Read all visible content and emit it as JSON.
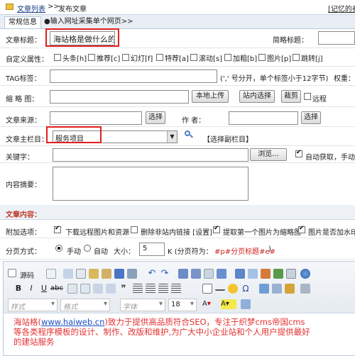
{
  "topbar": {
    "list_link": "文章列表",
    "sep": ">>",
    "current": "发布文章",
    "right_link": "[记忆的券"
  },
  "tabs": [
    "常规信息",
    "●输入网址采集单个网页>>"
  ],
  "title": {
    "label": "文章标题：",
    "value": "海站格是做什么的?",
    "short_label": "简略标题："
  },
  "attrs": {
    "label": "自定义属性：",
    "items": [
      "头条[h]",
      "推荐[c]",
      "幻灯[f]",
      "特荐[a]",
      "滚动[s]",
      "加粗[b]",
      "图片[p]",
      "跳转[j]"
    ]
  },
  "tag": {
    "label": "TAG标签：",
    "hint": "(',' 号分开，单个标签小于12字节)",
    "weight_label": "权重："
  },
  "thumb": {
    "label": "缩 略 图：",
    "upload": "本地上传",
    "site_select": "站内选择",
    "crop": "裁剪",
    "remote": "远程"
  },
  "source": {
    "label": "文章来源：",
    "select": "选择",
    "author_label": "作    者：",
    "author_select": "选择"
  },
  "column": {
    "label": "文章主栏目：",
    "value": "服务项目",
    "sub_column": "【选择副栏目】"
  },
  "keywords": {
    "label": "关键字：",
    "browse": "浏览...",
    "auto_label": "自动获取，手动填"
  },
  "summary": {
    "label": "内容摘要："
  },
  "content_header": "文章内容：",
  "options": {
    "label": "附加选项：",
    "items": [
      "下载远程图片和资源",
      "删除非站内链接 [设置]",
      "提取第一个图片为缩略图",
      "图片是否加水印"
    ],
    "checked": [
      true,
      false,
      true,
      true
    ]
  },
  "paging": {
    "label": "分页方式：",
    "manual": "手动",
    "auto": "自动",
    "size_label": "大小：",
    "size_value": "5",
    "unit": "K (分页符为：",
    "marker": "#p#分页标题#e#",
    "close": ")"
  },
  "editor": {
    "source_btn": "源码",
    "style_select": "样式",
    "format_select": "格式",
    "font_select": "字体",
    "size_select": "18",
    "content_link": "www.haiweb.cn",
    "content_pre": "海站格(",
    "content_post": ")致力于提供高品质符合SEO，专注于织梦cms帝国cms等各类程序模板的设计、制作、改版和维护,为广大中小企业站和个人用户提供最好的建站服务"
  },
  "colors": {
    "accent_red": "#e02020",
    "content_red": "#e53030",
    "link_blue": "#1a4fc4",
    "tab_bg": "#dfe8f2"
  }
}
